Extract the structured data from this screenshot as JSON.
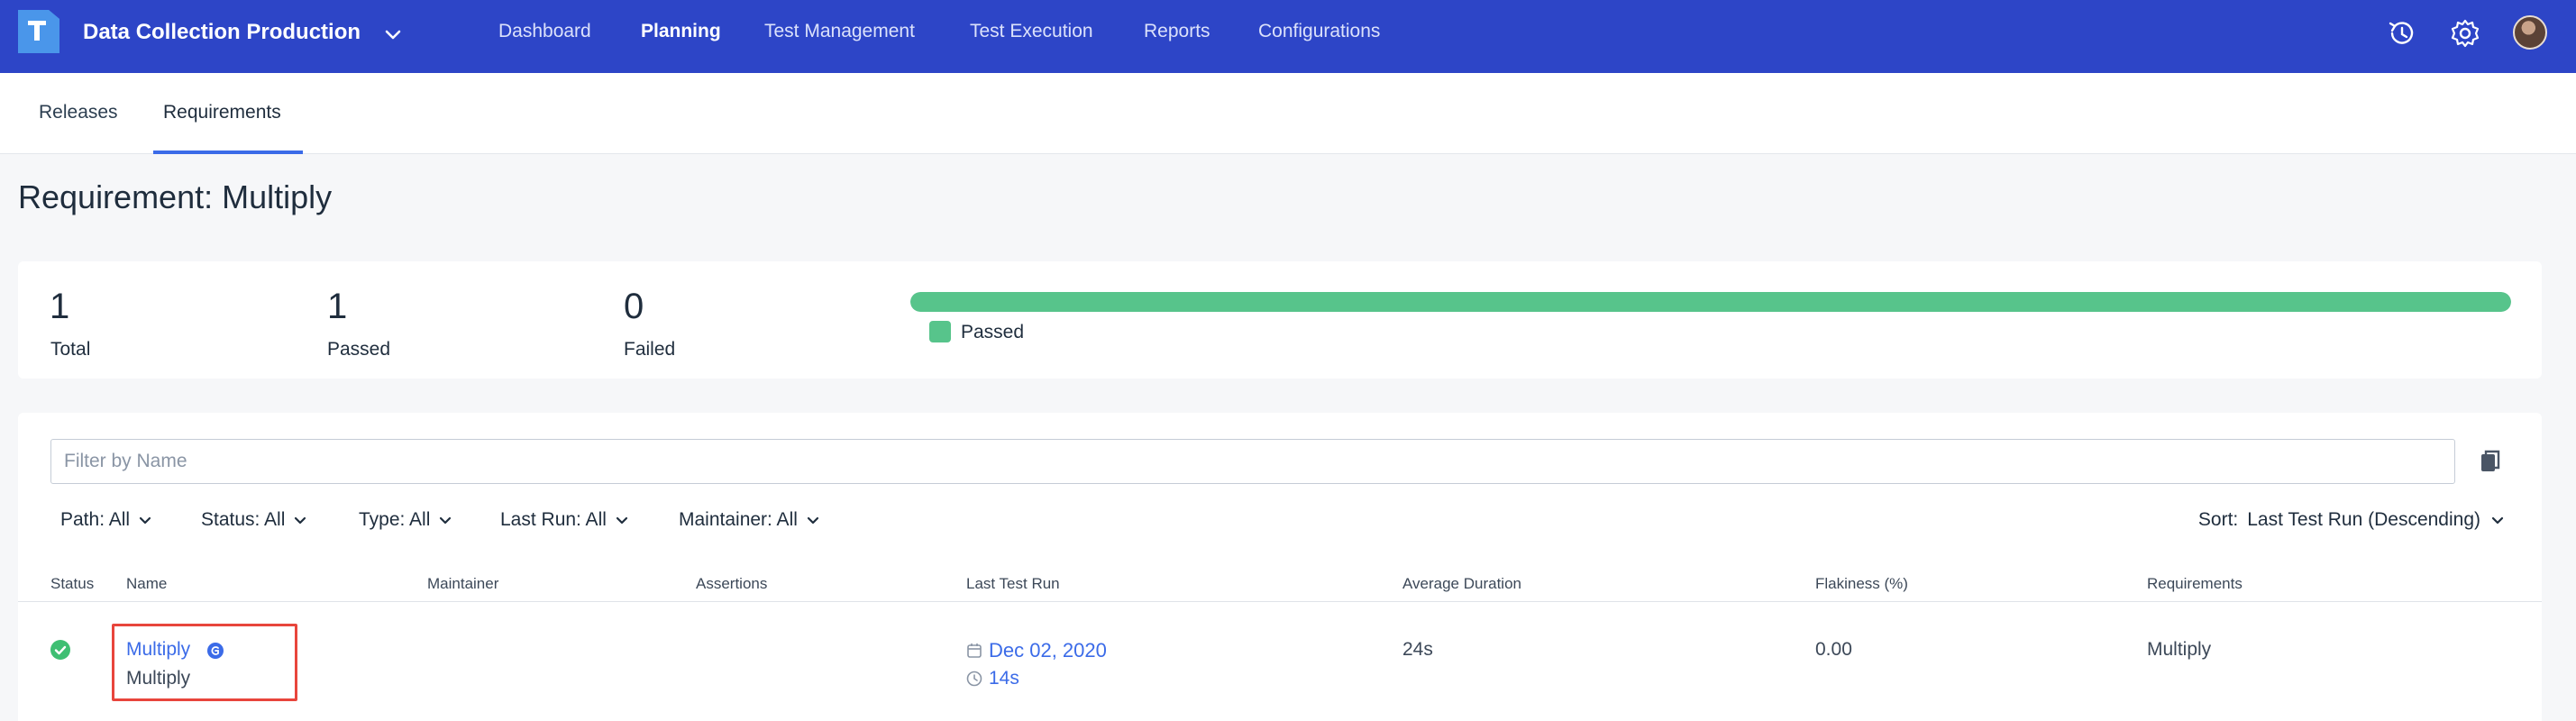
{
  "topbar": {
    "project": "Data Collection Production",
    "nav": [
      "Dashboard",
      "Planning",
      "Test Management",
      "Test Execution",
      "Reports",
      "Configurations"
    ],
    "active_nav": "Planning",
    "icons": [
      "history-icon",
      "settings-icon",
      "user-avatar"
    ]
  },
  "subtabs": [
    "Releases",
    "Requirements"
  ],
  "active_subtab": "Requirements",
  "page_title": "Requirement: Multiply",
  "summary": {
    "total": {
      "value": "1",
      "label": "Total"
    },
    "passed": {
      "value": "1",
      "label": "Passed"
    },
    "failed": {
      "value": "0",
      "label": "Failed"
    },
    "progress_passed_fraction": 1.0,
    "legend": "Passed",
    "pass_color": "#57c48b"
  },
  "filters": {
    "search_placeholder": "Filter by Name",
    "path": "Path: All",
    "status": "Status: All",
    "type": "Type: All",
    "last_run": "Last Run: All",
    "maintainer": "Maintainer: All",
    "sort_label": "Sort:",
    "sort_value": "Last Test Run (Descending)"
  },
  "table": {
    "columns": [
      "Status",
      "Name",
      "Maintainer",
      "Assertions",
      "Last Test Run",
      "Average Duration",
      "Flakiness (%)",
      "Requirements"
    ],
    "rows": [
      {
        "status": "passed",
        "name": "Multiply",
        "name_sub": "Multiply",
        "maintainer": "",
        "assertions": "",
        "last_run_date": "Dec 02, 2020",
        "last_run_duration": "14s",
        "average_duration": "24s",
        "flakiness": "0.00",
        "requirements": "Multiply"
      }
    ]
  },
  "colors": {
    "brand": "#2d45c7",
    "link": "#3b6be8",
    "highlight": "#e8453c"
  }
}
